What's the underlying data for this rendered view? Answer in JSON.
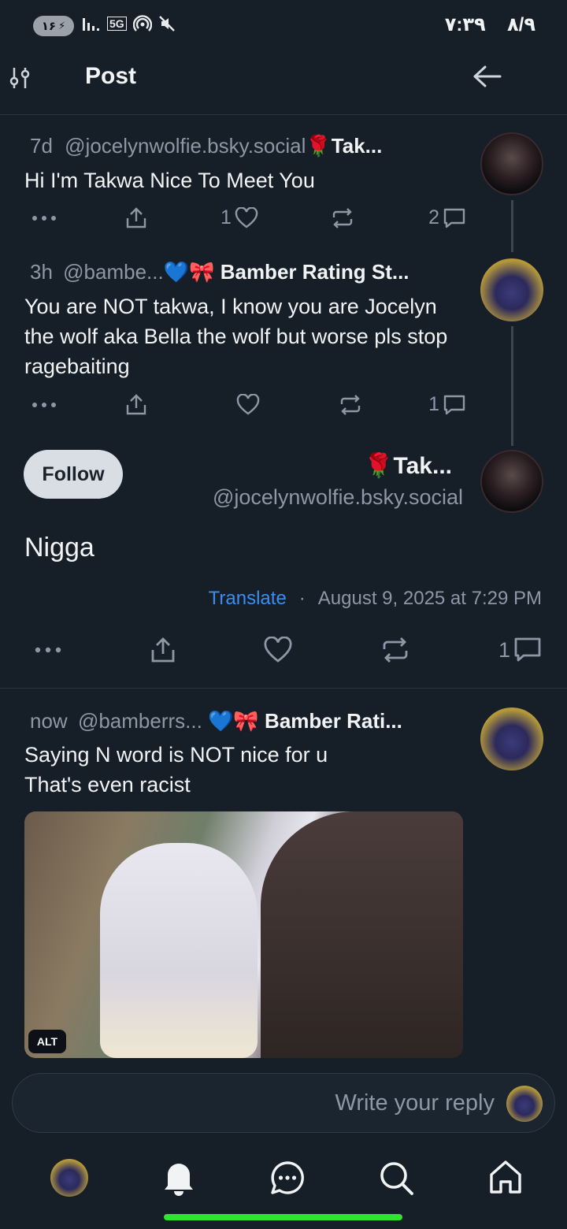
{
  "status_bar": {
    "battery": "۱۶",
    "network": "5G",
    "time": "۷:۳۹",
    "date": "۸/۹"
  },
  "header": {
    "title": "Post"
  },
  "thread": [
    {
      "time": "7d",
      "handle": "@jocelynwolfie.bsky.social",
      "display_name_emoji": "🌹",
      "display_name": "Tak...",
      "text": "Hi I'm Takwa Nice To Meet You",
      "likes": "1",
      "replies": "2"
    },
    {
      "time": "3h",
      "handle": "@bambe...",
      "display_name_emoji": "💙🎀",
      "display_name": "Bamber Rating St...",
      "text": "You are NOT takwa, I know you are Jocelyn the wolf aka Bella the wolf but worse pls stop ragebaiting",
      "replies": "1"
    }
  ],
  "main_post": {
    "follow_label": "Follow",
    "display_name_emoji": "🌹",
    "display_name": "Tak...",
    "handle": "@jocelynwolfie.bsky.social",
    "text": "Nigga",
    "translate_label": "Translate",
    "separator": "·",
    "timestamp": "August 9, 2025 at 7:29 PM",
    "replies": "1"
  },
  "reply_post": {
    "time": "now",
    "handle": "@bamberrs...",
    "display_name_emoji": "💙🎀",
    "display_name": "Bamber Rati...",
    "text_line1": "Saying N word is NOT nice for u",
    "text_line2": "That's even racist",
    "alt_label": "ALT"
  },
  "composer": {
    "placeholder": "Write your reply"
  },
  "colors": {
    "background": "#161e27",
    "accent_link": "#3b8ef0",
    "muted": "#8d97a5",
    "home_indicator": "#2ee62e"
  },
  "nav_icons": [
    "avatar",
    "bell-icon",
    "chat-icon",
    "search-icon",
    "home-icon"
  ]
}
